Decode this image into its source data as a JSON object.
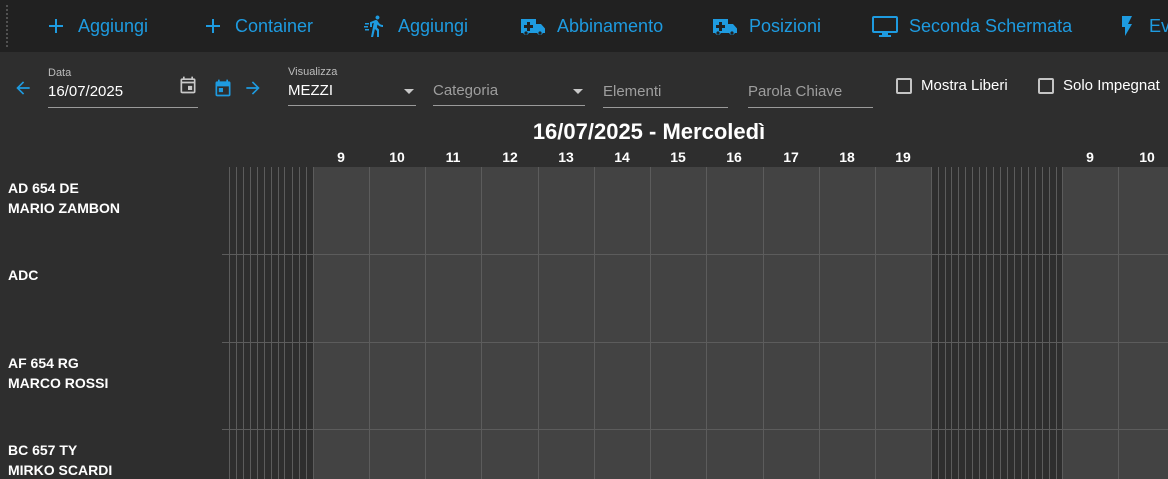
{
  "toolbar": {
    "items": [
      {
        "label": "Aggiungi",
        "icon": "plus-icon"
      },
      {
        "label": "Container",
        "icon": "plus-icon"
      },
      {
        "label": "Aggiungi",
        "icon": "running-person-icon"
      },
      {
        "label": "Abbinamento",
        "icon": "ambulance-icon"
      },
      {
        "label": "Posizioni",
        "icon": "ambulance-icon"
      },
      {
        "label": "Seconda Schermata",
        "icon": "monitor-icon"
      },
      {
        "label": "Ev",
        "icon": "lightning-icon"
      }
    ]
  },
  "filters": {
    "date_label": "Data",
    "date_value": "16/07/2025",
    "view_label": "Visualizza",
    "view_value": "MEZZI",
    "category_placeholder": "Categoria",
    "elements_placeholder": "Elementi",
    "keyword_placeholder": "Parola Chiave",
    "show_free_label": "Mostra Liberi",
    "show_free_checked": false,
    "only_busy_label": "Solo Impegnat",
    "only_busy_checked": false
  },
  "schedule": {
    "title": "16/07/2025 - Mercoledì",
    "hours": [
      "9",
      "10",
      "11",
      "12",
      "13",
      "14",
      "15",
      "16",
      "17",
      "18",
      "19",
      "9",
      "10"
    ],
    "rows": [
      {
        "line1": "AD 654 DE",
        "line2": "MARIO ZAMBON"
      },
      {
        "line1": "ADC",
        "line2": ""
      },
      {
        "line1": "AF 654 RG",
        "line2": "MARCO ROSSI"
      },
      {
        "line1": "BC 657 TY",
        "line2": "MIRKO SCARDI"
      }
    ]
  },
  "colors": {
    "accent": "#1e9be0",
    "toolbar_bg": "#212121",
    "page_bg": "#2e2e2e",
    "grid_band": "#434343",
    "grid_line": "#5c5c5c"
  }
}
